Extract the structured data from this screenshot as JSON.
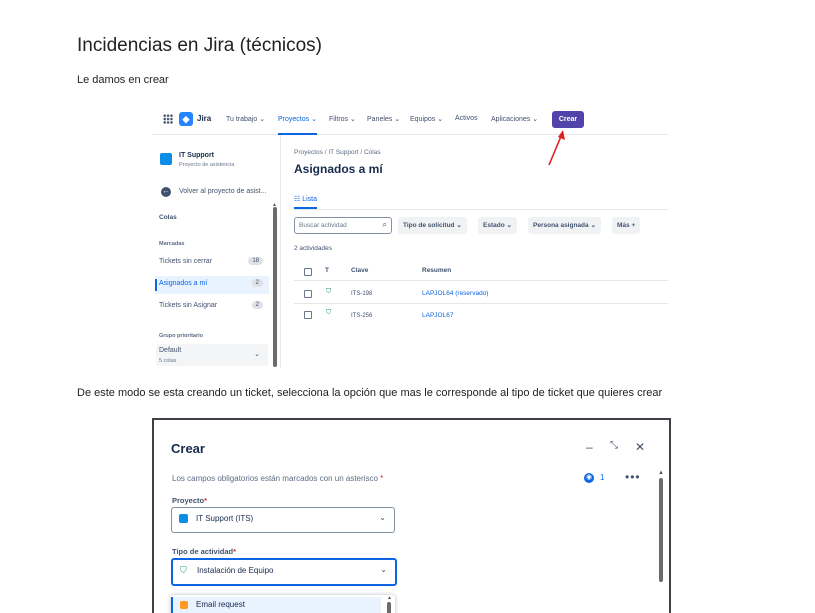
{
  "doc": {
    "title": "Incidencias en Jira (técnicos)",
    "p1": "Le damos en crear",
    "p2": "De este modo se esta creando un ticket, selecciona la opción que mas le corresponde al tipo de ticket que quieres crear"
  },
  "jira": {
    "brand": "Jira",
    "nav": [
      "Tu trabajo ⌄",
      "Proyectos ⌄",
      "Filtros ⌄",
      "Paneles ⌄",
      "Equipos ⌄",
      "Activos",
      "Aplicaciones ⌄"
    ],
    "create_label": "Crear",
    "sidebar": {
      "project_name": "IT Support",
      "project_type": "Proyecto de asistencia",
      "back_label": "Volver al proyecto de asist...",
      "queues_heading": "Colas",
      "starred_heading": "Marcadas",
      "queues": [
        {
          "label": "Tickets sin cerrar",
          "count": "18"
        },
        {
          "label": "Asignados a mí",
          "count": "2"
        },
        {
          "label": "Tickets sin Asignar",
          "count": "2"
        }
      ],
      "priority_heading": "Grupo prioritario",
      "group_label": "Default",
      "group_sub": "5 colas"
    },
    "main": {
      "breadcrumb": "Proyectos  /  IT Support  /  Colas",
      "title": "Asignados a mí",
      "tab": "Lista",
      "search_placeholder": "Buscar actividad",
      "filters": [
        "Tipo de solicitud  ⌄",
        "Estado  ⌄",
        "Persona asignada  ⌄",
        "Más  +"
      ],
      "activity_count": "2 actividades",
      "columns": [
        "T",
        "Clave",
        "Resumen"
      ],
      "rows": [
        {
          "key": "ITS-198",
          "summary": "LAPJOL64 (reservado)"
        },
        {
          "key": "ITS-256",
          "summary": "LAPJOL67"
        }
      ]
    }
  },
  "modal": {
    "title": "Crear",
    "required_note": "Los campos obligatorios están marcados con un asterisco",
    "watch_count": "1",
    "project_label": "Proyecto",
    "project_value": "IT Support (ITS)",
    "type_label": "Tipo de actividad",
    "type_value": "Instalación de Equipo",
    "option": "Email request"
  }
}
